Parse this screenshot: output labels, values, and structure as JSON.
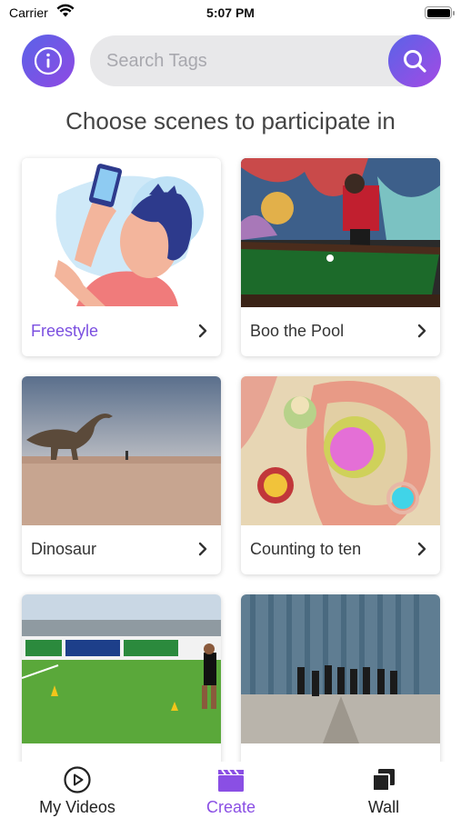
{
  "status_bar": {
    "carrier": "Carrier",
    "time": "5:07 PM"
  },
  "header": {
    "info_icon": "info-icon",
    "search": {
      "placeholder": "Search Tags",
      "value": ""
    },
    "search_icon": "search-icon"
  },
  "heading": "Choose scenes to participate in",
  "scenes": [
    {
      "label": "Freestyle"
    },
    {
      "label": "Boo the Pool"
    },
    {
      "label": "Dinosaur"
    },
    {
      "label": "Counting to ten"
    },
    {
      "label": ""
    },
    {
      "label": ""
    }
  ],
  "tabs": [
    {
      "label": "My Videos",
      "icon": "play-circle-icon"
    },
    {
      "label": "Create",
      "icon": "clapperboard-icon"
    },
    {
      "label": "Wall",
      "icon": "stacked-squares-icon"
    }
  ],
  "colors": {
    "accent": "#8a4fe4",
    "gradient_start": "#5a63e8",
    "gradient_end": "#a34ae4"
  }
}
